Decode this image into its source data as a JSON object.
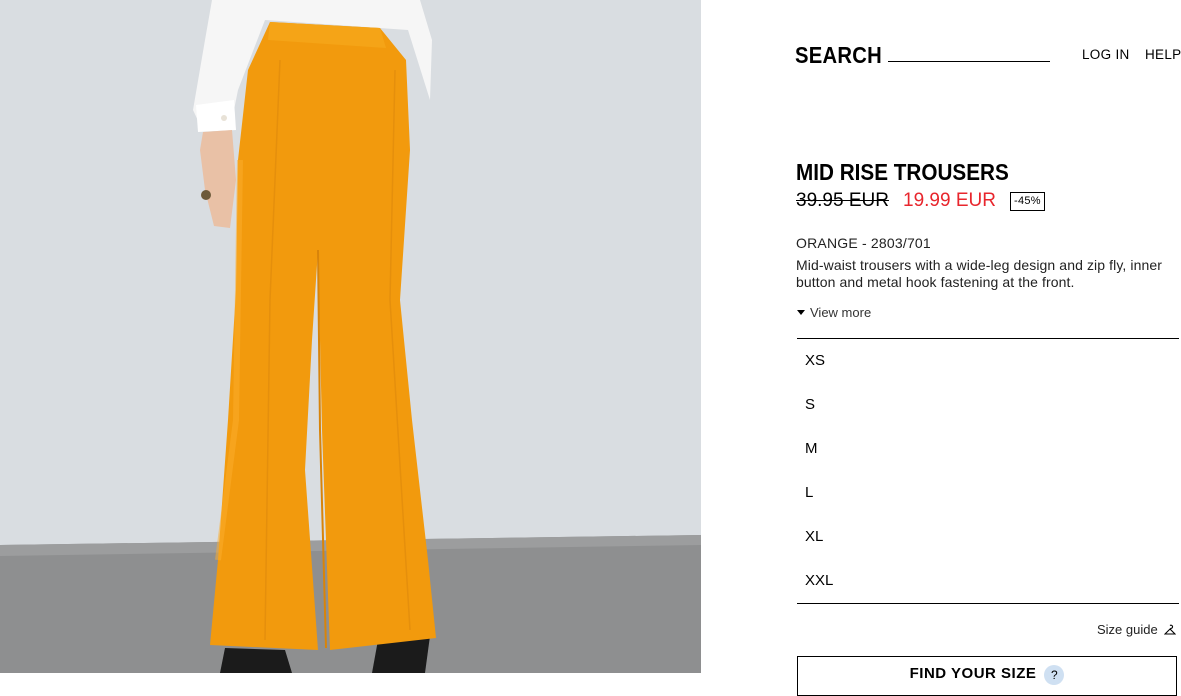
{
  "header": {
    "search_label": "SEARCH",
    "login_label": "LOG IN",
    "help_label": "HELP"
  },
  "product": {
    "image_alt": "Woman wearing orange wide-leg trousers, back view",
    "title": "MID RISE TROUSERS",
    "old_price": "39.95 EUR",
    "new_price": "19.99 EUR",
    "discount": "-45%",
    "color_ref": "ORANGE - 2803/701",
    "description": "Mid-waist trousers with a wide-leg design and zip fly, inner button and metal hook fastening at the front.",
    "view_more": "View more"
  },
  "sizes": [
    "XS",
    "S",
    "M",
    "L",
    "XL",
    "XXL"
  ],
  "size_guide": "Size guide",
  "find_size_button": {
    "label": "FIND YOUR SIZE",
    "icon_text": "?"
  },
  "colors": {
    "sale_red": "#e8262d",
    "trouser_orange": "#f29a0d",
    "background": "#ffffff"
  }
}
